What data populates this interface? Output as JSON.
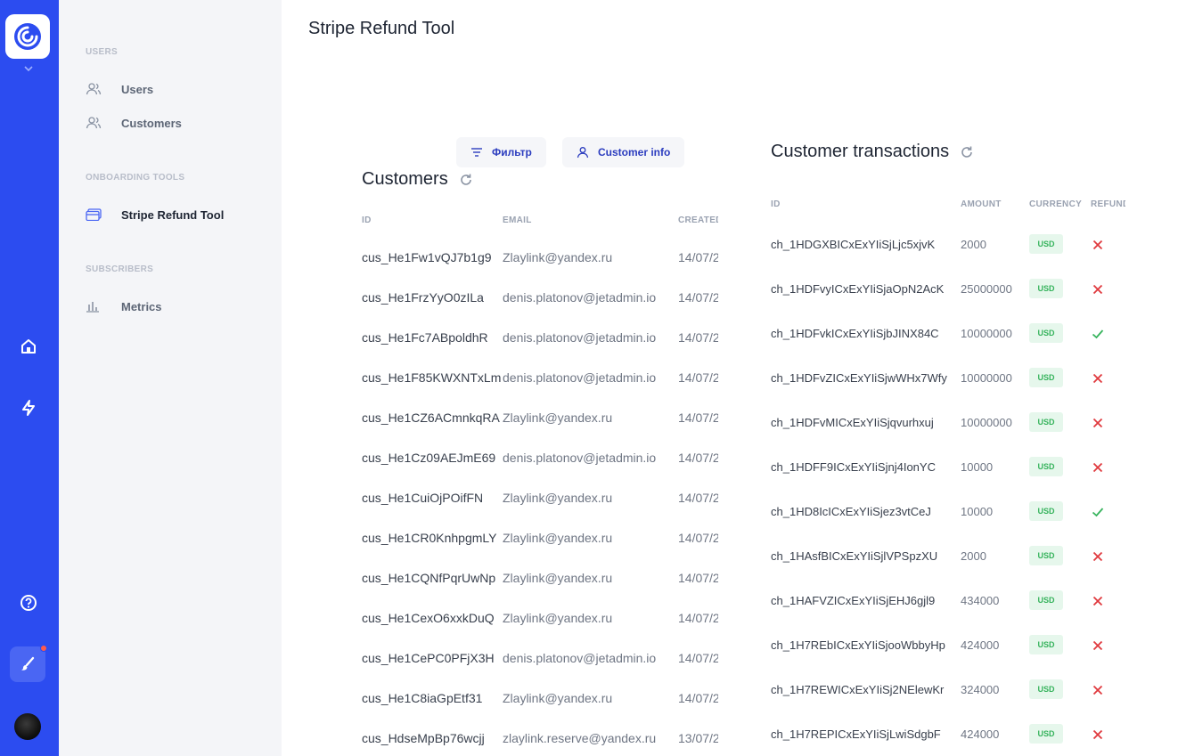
{
  "app": {
    "page_title": "Stripe Refund Tool"
  },
  "sidebar": {
    "sections": [
      {
        "title": "USERS",
        "items": [
          {
            "label": "Users",
            "icon": "users-icon"
          },
          {
            "label": "Customers",
            "icon": "users-icon"
          }
        ]
      },
      {
        "title": "ONBOARDING TOOLS",
        "items": [
          {
            "label": "Stripe Refund Tool",
            "icon": "card-icon"
          }
        ]
      },
      {
        "title": "SUBSCRIBERS",
        "items": [
          {
            "label": "Metrics",
            "icon": "bar-chart-icon"
          }
        ]
      }
    ]
  },
  "toolbar": {
    "filter_label": "Фильтр",
    "customer_info_label": "Customer info"
  },
  "customers": {
    "title": "Customers",
    "columns": [
      "ID",
      "EMAIL",
      "CREATED"
    ],
    "rows": [
      [
        "cus_He1Fw1vQJ7b1g9",
        "Zlaylink@yandex.ru",
        "14/07/2"
      ],
      [
        "cus_He1FrzYyO0zILa",
        "denis.platonov@jetadmin.io",
        "14/07/2"
      ],
      [
        "cus_He1Fc7ABpoldhR",
        "denis.platonov@jetadmin.io",
        "14/07/2"
      ],
      [
        "cus_He1F85KWXNTxLm",
        "denis.platonov@jetadmin.io",
        "14/07/2"
      ],
      [
        "cus_He1CZ6ACmnkqRA",
        "Zlaylink@yandex.ru",
        "14/07/2"
      ],
      [
        "cus_He1Cz09AEJmE69",
        "denis.platonov@jetadmin.io",
        "14/07/2"
      ],
      [
        "cus_He1CuiOjPOifFN",
        "Zlaylink@yandex.ru",
        "14/07/2"
      ],
      [
        "cus_He1CR0KnhpgmLY",
        "Zlaylink@yandex.ru",
        "14/07/2"
      ],
      [
        "cus_He1CQNfPqrUwNp",
        "Zlaylink@yandex.ru",
        "14/07/2"
      ],
      [
        "cus_He1CexO6xxkDuQ",
        "Zlaylink@yandex.ru",
        "14/07/2"
      ],
      [
        "cus_He1CePC0PFjX3H",
        "denis.platonov@jetadmin.io",
        "14/07/2"
      ],
      [
        "cus_He1C8iaGpEtf31",
        "Zlaylink@yandex.ru",
        "14/07/2"
      ],
      [
        "cus_HdseMpBp76wcjj",
        "zlaylink.reserve@yandex.ru",
        "13/07/2"
      ]
    ]
  },
  "transactions": {
    "title": "Customer transactions",
    "columns": [
      "ID",
      "AMOUNT",
      "CURRENCY",
      "REFUND"
    ],
    "rows": [
      {
        "id": "ch_1HDGXBICxExYIiSjLjc5xjvK",
        "amount": "2000",
        "currency": "USD",
        "refunded": false
      },
      {
        "id": "ch_1HDFvyICxExYIiSjaOpN2AcK",
        "amount": "25000000",
        "currency": "USD",
        "refunded": false
      },
      {
        "id": "ch_1HDFvkICxExYIiSjbJINX84C",
        "amount": "10000000",
        "currency": "USD",
        "refunded": true
      },
      {
        "id": "ch_1HDFvZICxExYIiSjwWHx7Wfy",
        "amount": "10000000",
        "currency": "USD",
        "refunded": false
      },
      {
        "id": "ch_1HDFvMICxExYIiSjqvurhxuj",
        "amount": "10000000",
        "currency": "USD",
        "refunded": false
      },
      {
        "id": "ch_1HDFF9ICxExYIiSjnj4IonYC",
        "amount": "10000",
        "currency": "USD",
        "refunded": false
      },
      {
        "id": "ch_1HD8IcICxExYIiSjez3vtCeJ",
        "amount": "10000",
        "currency": "USD",
        "refunded": true
      },
      {
        "id": "ch_1HAsfBICxExYIiSjlVPSpzXU",
        "amount": "2000",
        "currency": "USD",
        "refunded": false
      },
      {
        "id": "ch_1HAFVZICxExYIiSjEHJ6gjl9",
        "amount": "434000",
        "currency": "USD",
        "refunded": false
      },
      {
        "id": "ch_1H7REbICxExYIiSjooWbbyHp",
        "amount": "424000",
        "currency": "USD",
        "refunded": false
      },
      {
        "id": "ch_1H7REWICxExYIiSj2NElewKr",
        "amount": "324000",
        "currency": "USD",
        "refunded": false
      },
      {
        "id": "ch_1H7REPICxExYIiSjLwiSdgbF",
        "amount": "424000",
        "currency": "USD",
        "refunded": false
      }
    ]
  },
  "colors": {
    "rail": "#2c4cf0",
    "accent_text": "#2c3dbf",
    "usd_bg": "#e6f7ec",
    "usd_text": "#36b35c",
    "refund_yes": "#36b35c",
    "refund_no": "#e0393e"
  }
}
